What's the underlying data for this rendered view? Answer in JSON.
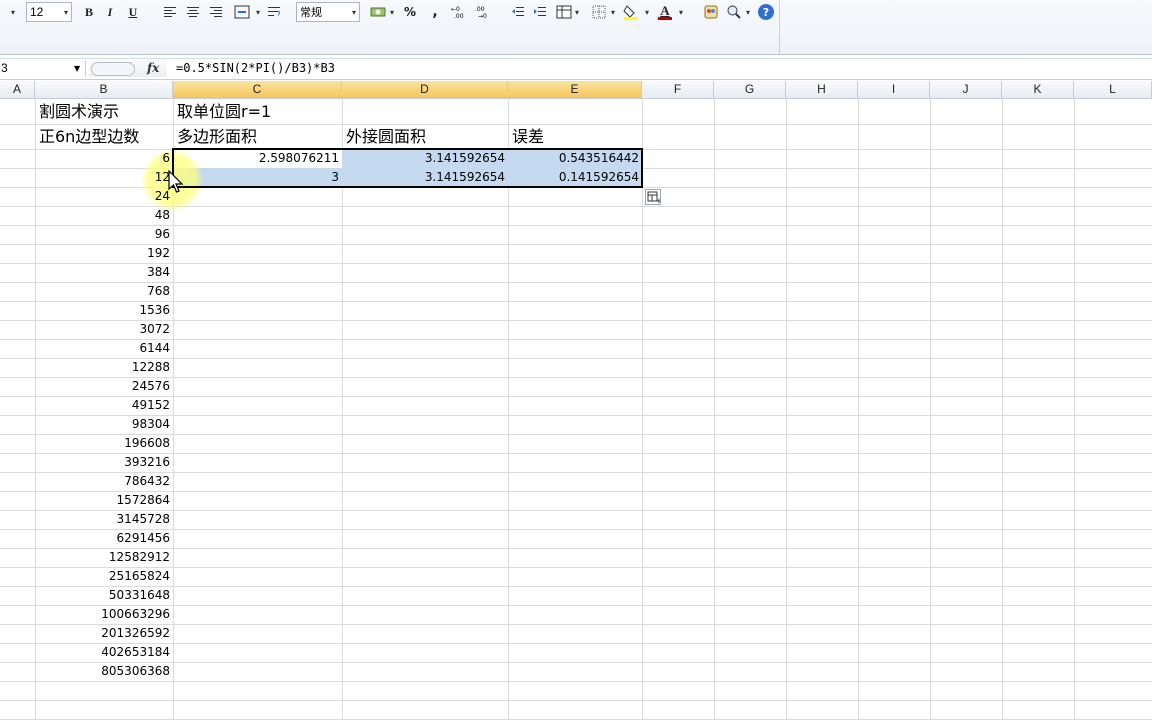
{
  "toolbar": {
    "font_size": "12",
    "number_format": "常规",
    "bold_label": "B",
    "italic_label": "I",
    "underline_label": "U",
    "percent_label": "%",
    "comma_label": ",",
    "font_color": "#c00000",
    "fill_color": "#ffff00"
  },
  "formula_bar": {
    "name_box": "3",
    "fx_label": "fx",
    "formula": "=0.5*SIN(2*PI()/B3)*B3"
  },
  "columns": [
    "A",
    "B",
    "C",
    "D",
    "E",
    "F",
    "G",
    "H",
    "I",
    "J",
    "K",
    "L"
  ],
  "selected_columns": [
    "C",
    "D",
    "E"
  ],
  "cells": {
    "b1": "割圆术演示",
    "c1": "取单位圆r=1",
    "b2": "正6n边型边数",
    "c2": "多边形面积",
    "d2": "外接圆面积",
    "e2": "误差",
    "row3": [
      "6",
      "2.598076211",
      "3.141592654",
      "0.543516442"
    ],
    "row4": [
      "12",
      "3",
      "3.141592654",
      "0.141592654"
    ]
  },
  "b_values": [
    "24",
    "48",
    "96",
    "192",
    "384",
    "768",
    "1536",
    "3072",
    "6144",
    "12288",
    "24576",
    "49152",
    "98304",
    "196608",
    "393216",
    "786432",
    "1572864",
    "3145728",
    "6291456",
    "12582912",
    "25165824",
    "50331648",
    "100663296",
    "201326592",
    "402653184",
    "805306368"
  ],
  "colors": {
    "selection": "#c5d9f1",
    "header_selected": "#f6c65c"
  }
}
